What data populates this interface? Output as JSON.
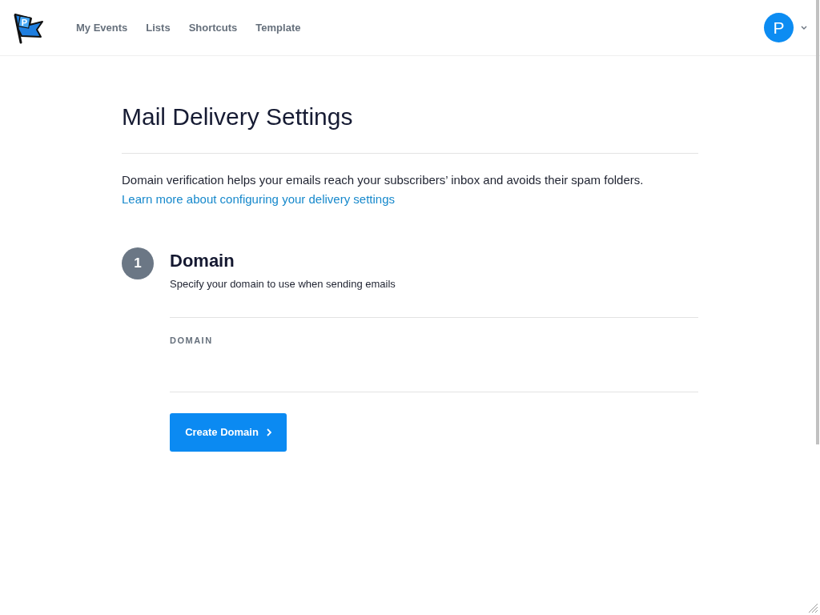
{
  "header": {
    "logo": {
      "letter": "P"
    },
    "nav": [
      {
        "label": "My Events"
      },
      {
        "label": "Lists"
      },
      {
        "label": "Shortcuts"
      },
      {
        "label": "Template"
      }
    ],
    "user_menu": {
      "avatar_initial": "P"
    }
  },
  "page": {
    "title": "Mail Delivery Settings",
    "description": "Domain verification helps your emails reach your subscribers’ inbox and avoids their spam folders.",
    "link": "Learn more about configuring your delivery settings"
  },
  "steps": [
    {
      "number": "1",
      "title": "Domain",
      "subtitle": "Specify your domain to use when sending emails",
      "fields": [
        {
          "label": "DOMAIN"
        }
      ],
      "button": {
        "label": "Create Domain"
      }
    }
  ]
}
